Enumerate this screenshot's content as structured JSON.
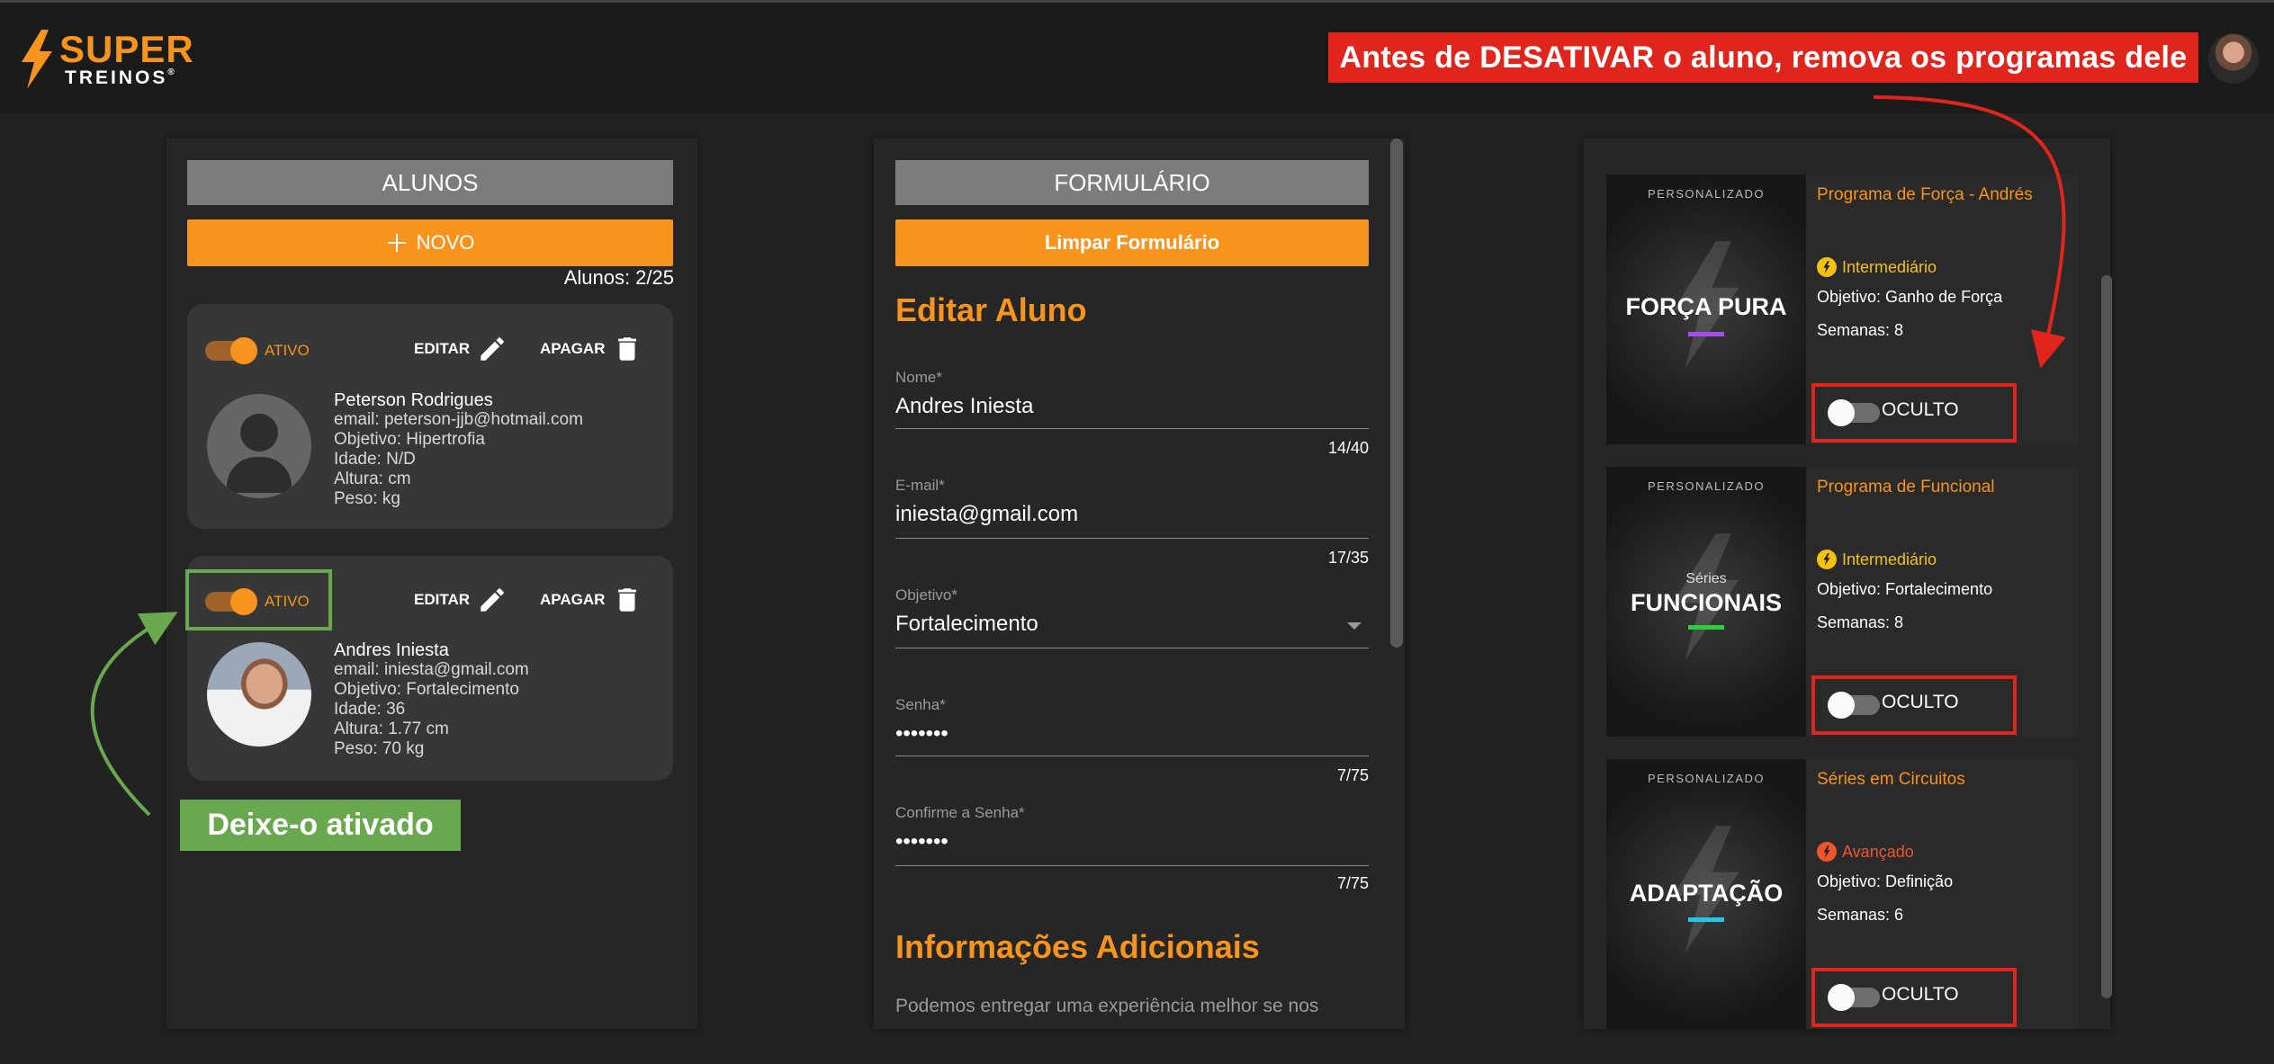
{
  "brand": {
    "line1": "SUPER",
    "line2": "TREINOS",
    "reg": "®",
    "accent": "#f7941d"
  },
  "annotations": {
    "warning": "Antes de DESATIVAR o aluno, remova os programas dele",
    "keep_active": "Deixe-o ativado"
  },
  "students_panel": {
    "header": "ALUNOS",
    "new_button": "NOVO",
    "count": "Alunos: 2/25",
    "students": [
      {
        "status": "ATIVO",
        "edit": "EDITAR",
        "delete": "APAGAR",
        "name": "Peterson Rodrigues",
        "email": "email: peterson-jjb@hotmail.com",
        "goal": "Objetivo: Hipertrofia",
        "age": "Idade: N/D",
        "height": "Altura: cm",
        "weight": "Peso: kg"
      },
      {
        "status": "ATIVO",
        "edit": "EDITAR",
        "delete": "APAGAR",
        "name": "Andres Iniesta",
        "email": "email: iniesta@gmail.com",
        "goal": "Objetivo: Fortalecimento",
        "age": "Idade: 36",
        "height": "Altura: 1.77 cm",
        "weight": "Peso: 70 kg"
      }
    ]
  },
  "form_panel": {
    "header": "FORMULÁRIO",
    "clear_button": "Limpar Formulário",
    "title": "Editar Aluno",
    "fields": {
      "name": {
        "label": "Nome*",
        "value": "Andres Iniesta",
        "counter": "14/40"
      },
      "email": {
        "label": "E-mail*",
        "value": "iniesta@gmail.com",
        "counter": "17/35"
      },
      "goal": {
        "label": "Objetivo*",
        "value": "Fortalecimento"
      },
      "password": {
        "label": "Senha*",
        "value": "•••••••",
        "counter": "7/75"
      },
      "confirm": {
        "label": "Confirme a Senha*",
        "value": "•••••••",
        "counter": "7/75"
      }
    },
    "additional_title": "Informações Adicionais",
    "additional_text": "Podemos entregar uma experiência melhor se nos contar"
  },
  "programs_panel": {
    "programs": [
      {
        "badge": "PERSONALIZADO",
        "thumb_small": "",
        "thumb_title": "FORÇA PURA",
        "bar_color": "#a64df0",
        "title": "Programa de Força - Andrés",
        "level": "Intermediário",
        "level_color": "#f4c20d",
        "goal": "Objetivo: Ganho de Força",
        "weeks": "Semanas: 8",
        "visibility": "OCULTO"
      },
      {
        "badge": "PERSONALIZADO",
        "thumb_small": "Séries",
        "thumb_title": "FUNCIONAIS",
        "bar_color": "#2ecc40",
        "title": "Programa de Funcional",
        "level": "Intermediário",
        "level_color": "#f4c20d",
        "goal": "Objetivo: Fortalecimento",
        "weeks": "Semanas: 8",
        "visibility": "OCULTO"
      },
      {
        "badge": "PERSONALIZADO",
        "thumb_small": "",
        "thumb_title": "ADAPTAÇÃO",
        "bar_color": "#29c5e6",
        "title": "Séries em Circuitos",
        "level": "Avançado",
        "level_color": "#f0542d",
        "goal": "Objetivo: Definição",
        "weeks": "Semanas: 6",
        "visibility": "OCULTO"
      }
    ]
  }
}
